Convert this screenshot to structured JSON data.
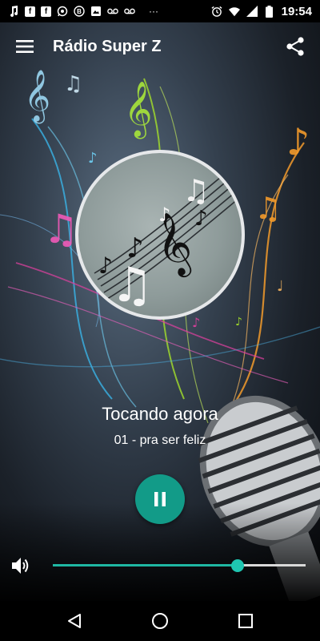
{
  "status_bar": {
    "time": "19:54",
    "left_icons": [
      "music-note-icon",
      "facebook-icon",
      "facebook-icon",
      "whatsapp-icon",
      "b-icon",
      "image-icon",
      "voicemail-icon",
      "voicemail-icon",
      "more-icon"
    ],
    "right_icons": [
      "alarm-icon",
      "wifi-icon",
      "signal-icon",
      "battery-icon"
    ],
    "more_label": "···",
    "fb_letter": "f",
    "b_letter": "B"
  },
  "app_bar": {
    "title": "Rádio Super Z",
    "menu_icon": "menu-icon",
    "share_icon": "share-icon"
  },
  "player": {
    "now_playing_label": "Tocando agora",
    "track_title": "01 - pra ser feliz",
    "state": "playing",
    "play_button_icon": "pause-icon",
    "accent_color": "#129b88"
  },
  "volume": {
    "icon": "volume-icon",
    "level": 0.73
  },
  "nav_bar": {
    "back_icon": "back-triangle-icon",
    "home_icon": "home-circle-icon",
    "recents_icon": "recents-square-icon"
  }
}
